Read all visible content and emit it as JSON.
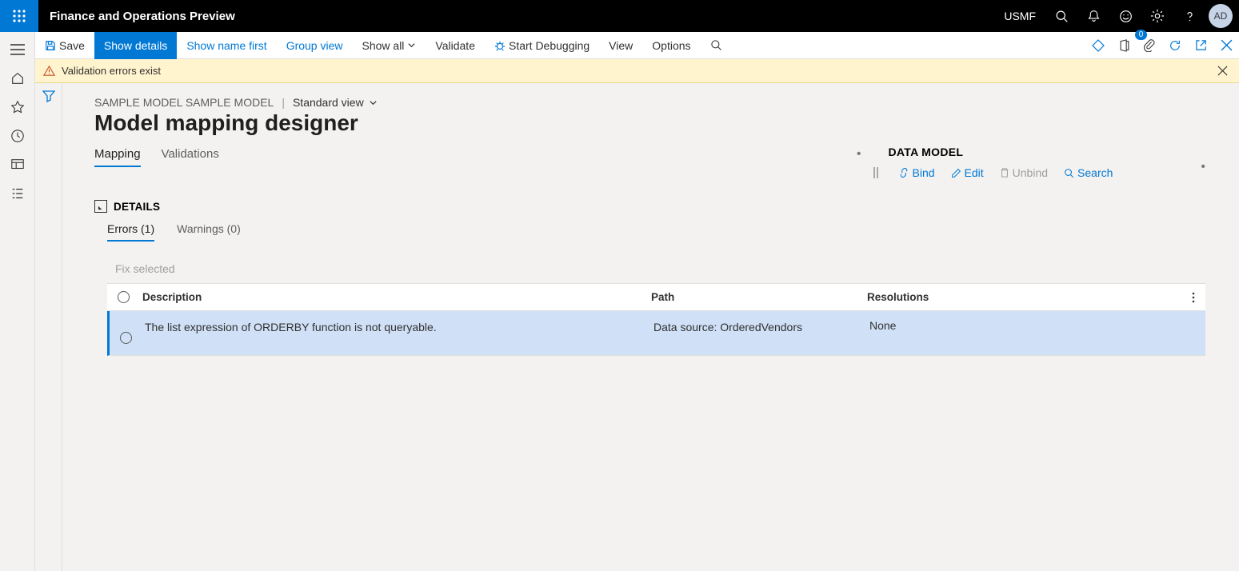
{
  "topbar": {
    "app_title": "Finance and Operations Preview",
    "org": "USMF",
    "avatar": "AD"
  },
  "toolbar": {
    "save": "Save",
    "show_details": "Show details",
    "show_name_first": "Show name first",
    "group_view": "Group view",
    "show_all": "Show all",
    "validate": "Validate",
    "start_debugging": "Start Debugging",
    "view": "View",
    "options": "Options",
    "attachment_count": "0"
  },
  "banner": {
    "text": "Validation errors exist"
  },
  "breadcrumb": {
    "path": "SAMPLE MODEL SAMPLE MODEL",
    "view": "Standard view"
  },
  "page_title": "Model mapping designer",
  "tabs": {
    "mapping": "Mapping",
    "validations": "Validations"
  },
  "datamodel": {
    "title": "DATA MODEL",
    "bind": "Bind",
    "edit": "Edit",
    "unbind": "Unbind",
    "search": "Search"
  },
  "details": {
    "label": "DETAILS",
    "errors_tab": "Errors (1)",
    "warnings_tab": "Warnings (0)",
    "fix_selected": "Fix selected",
    "columns": {
      "description": "Description",
      "path": "Path",
      "resolutions": "Resolutions"
    },
    "rows": [
      {
        "description": "The list expression of ORDERBY function is not queryable.",
        "path": "Data source: OrderedVendors",
        "resolutions": "None"
      }
    ]
  }
}
